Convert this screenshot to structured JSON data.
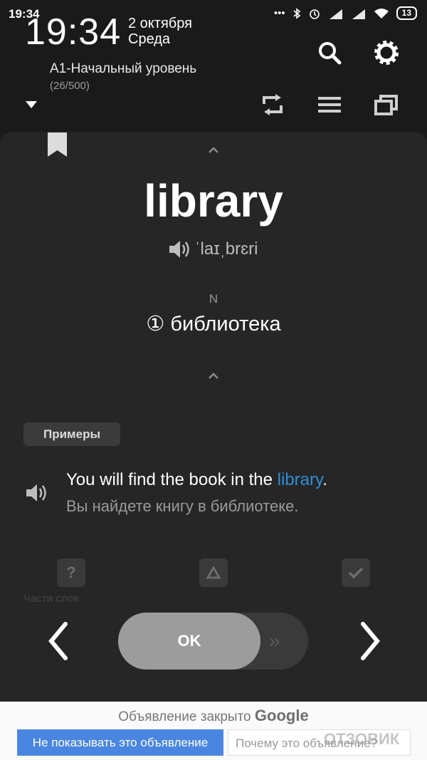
{
  "status_bar": {
    "time": "19:34",
    "icons": [
      "dots-icon",
      "bluetooth-icon",
      "alarm-icon",
      "signal-icon",
      "signal-icon",
      "wifi-icon"
    ],
    "battery": "13"
  },
  "header": {
    "clock": "19:34",
    "date_line1": "2 октября",
    "date_line2": "Среда",
    "level_title": "A1-Начальный уровень",
    "level_count": "(26/500)"
  },
  "card": {
    "word": "library",
    "pronunciation": "ˈlaɪˌbrɛri",
    "part_of_speech": "N",
    "translation": "① библиотека",
    "examples_label": "Примеры",
    "example_en_before": "You will find the book in the ",
    "example_en_highlight": "library",
    "example_en_after": ".",
    "example_ru": "Вы найдете книгу в библиотеке.",
    "tool_label": "Части слов",
    "tool_help_glyph": "?"
  },
  "controls": {
    "ok_label": "OK",
    "next_glyph": "»"
  },
  "ad": {
    "title": "Объявление закрыто",
    "brand": "Google",
    "hide_button": "Не показывать это объявление",
    "why_button": "Почему это объявление?"
  },
  "watermark": "ОТЗОВИК",
  "colors": {
    "accent": "#2d8fd5",
    "background": "#1c1c1c",
    "card": "#262626",
    "ad_button": "#4a86e0"
  }
}
